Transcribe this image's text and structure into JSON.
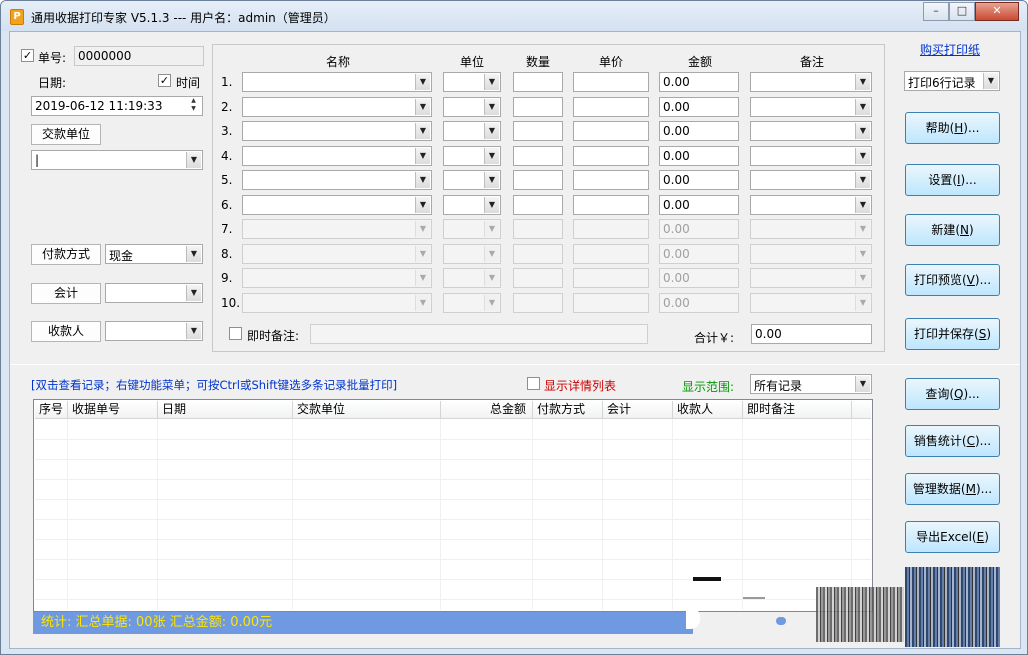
{
  "window": {
    "title": "通用收据打印专家 V5.1.3 --- 用户名：admin（管理员）",
    "buttons": [
      "–",
      "□",
      "✕"
    ]
  },
  "left": {
    "receipt_no_label": "单号:",
    "receipt_no_value": "0000000",
    "receipt_no_checked": "✓",
    "date_label": "日期:",
    "time_label": "时间",
    "time_checked": "✓",
    "date_value": "2019-06-12 11:19:33",
    "payer_button": "交款单位",
    "payer_value": "",
    "payment_method_label": "付款方式",
    "payment_method_value": "现金",
    "accountant_label": "会计",
    "accountant_value": "",
    "receiver_label": "收款人",
    "receiver_value": ""
  },
  "items": {
    "headers": [
      "名称",
      "单位",
      "数量",
      "单价",
      "金额",
      "备注"
    ],
    "rows": [
      {
        "no": "1.",
        "amount": "0.00"
      },
      {
        "no": "2.",
        "amount": "0.00"
      },
      {
        "no": "3.",
        "amount": "0.00"
      },
      {
        "no": "4.",
        "amount": "0.00"
      },
      {
        "no": "5.",
        "amount": "0.00"
      },
      {
        "no": "6.",
        "amount": "0.00"
      },
      {
        "no": "7.",
        "amount": "0.00"
      },
      {
        "no": "8.",
        "amount": "0.00"
      },
      {
        "no": "9.",
        "amount": "0.00"
      },
      {
        "no": "10.",
        "amount": "0.00"
      }
    ],
    "enabled_rows": 6,
    "instant_note_label": "即时备注:",
    "total_label": "合计￥:",
    "total_value": "0.00"
  },
  "right": {
    "buy_paper_link": "购买打印纸",
    "print_rows_select": "打印6行记录",
    "help": {
      "text": "帮助(",
      "key": "H",
      "tail": ")..."
    },
    "settings": {
      "text": "设置(",
      "key": "I",
      "tail": ")..."
    },
    "new": {
      "text": "新建(",
      "key": "N",
      "tail": ")"
    },
    "print_preview": {
      "text": "打印预览(",
      "key": "V",
      "tail": ")..."
    },
    "print_save": {
      "text": "打印并保存(",
      "key": "S",
      "tail": ")"
    },
    "query": {
      "text": "查询(",
      "key": "Q",
      "tail": ")..."
    },
    "sales_stats": {
      "text": "销售统计(",
      "key": "C",
      "tail": ")..."
    },
    "manage_data": {
      "text": "管理数据(",
      "key": "M",
      "tail": ")..."
    },
    "export_excel": {
      "text": "导出Excel(",
      "key": "E",
      "tail": ")"
    }
  },
  "records": {
    "hint": "[双击查看记录；右键功能菜单；可按Ctrl或Shift键选多条记录批量打印]",
    "show_detail_label": "显示详情列表",
    "range_label": "显示范围:",
    "range_value": "所有记录",
    "columns": [
      "序号",
      "收据单号",
      "日期",
      "交款单位",
      "总金额",
      "付款方式",
      "会计",
      "收款人",
      "即时备注"
    ]
  },
  "status": {
    "text": "统计:   汇总单据: 00张    汇总金额: 0.00元"
  },
  "colors": {
    "status_bg": "#6f99e0",
    "status_fg": "#ffe600",
    "hint_blue": "#0033cc",
    "red_label": "#cc0000",
    "green_label": "#009900"
  }
}
